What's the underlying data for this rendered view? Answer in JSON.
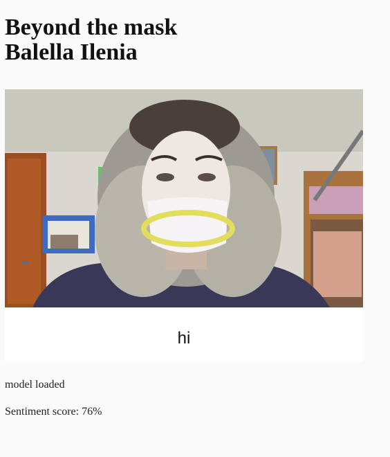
{
  "header": {
    "title_line1": "Beyond the mask",
    "title_line2": "Balella Ilenia"
  },
  "video": {
    "overlay_shape": "mouth-ellipse",
    "overlay_color": "#e2dd5c"
  },
  "caption": {
    "text": "hi"
  },
  "status": {
    "model": "model loaded",
    "sentiment_label": "Sentiment score: ",
    "sentiment_value": "76%"
  },
  "colors": {
    "background": "#fafafa",
    "caption_bg": "#ffffff",
    "text": "#111111"
  }
}
